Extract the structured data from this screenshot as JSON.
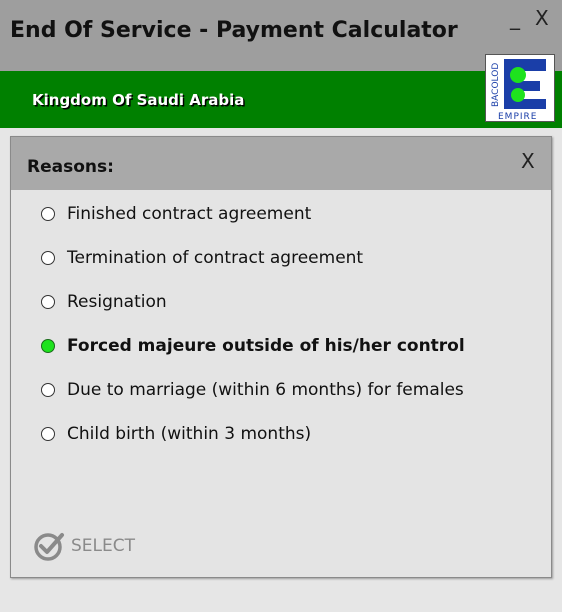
{
  "window": {
    "title": "End Of Service - Payment Calculator",
    "minimize_label": "_",
    "close_label": "X"
  },
  "banner": {
    "text": "Kingdom Of Saudi Arabia"
  },
  "logo": {
    "letter": "E",
    "vertical_text": "BACOLOD",
    "bottom_text": "EMPIRE",
    "colors": {
      "blue": "#1a3ea8",
      "green": "#1ee21e"
    }
  },
  "panel": {
    "title": "Reasons:",
    "close_label": "X"
  },
  "reasons": [
    {
      "label": "Finished contract agreement",
      "selected": false
    },
    {
      "label": "Termination of contract agreement",
      "selected": false
    },
    {
      "label": "Resignation",
      "selected": false
    },
    {
      "label": "Forced majeure outside of his/her control",
      "selected": true
    },
    {
      "label": "Due to marriage (within 6 months) for females",
      "selected": false
    },
    {
      "label": "Child birth (within 3 months)",
      "selected": false
    }
  ],
  "select_button": {
    "label": "SELECT",
    "icon": "check-circle-icon"
  },
  "colors": {
    "titlebar": "#9e9e9e",
    "banner": "#008000",
    "panel_header": "#a9a9a9",
    "radio_checked": "#1ee21e"
  }
}
